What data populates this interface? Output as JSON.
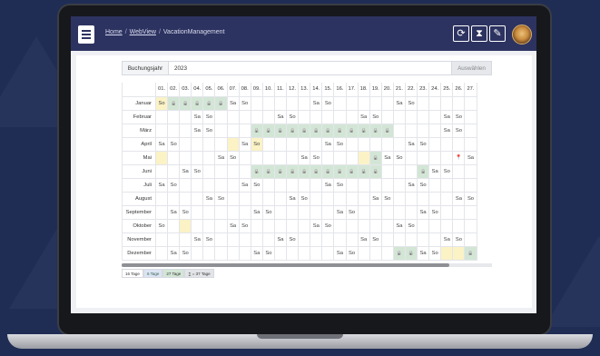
{
  "breadcrumb": {
    "home": "Home",
    "webview": "WebView",
    "current": "VacationManagement",
    "separator": "/"
  },
  "toolbar": {
    "icons": [
      "refresh-icon",
      "hourglass-icon",
      "pencil-icon"
    ]
  },
  "year_selector": {
    "label": "Buchungsjahr",
    "value": "2023",
    "button": "Auswählen"
  },
  "calendar": {
    "day_headers": [
      "01.",
      "02.",
      "03.",
      "04.",
      "05.",
      "06.",
      "07.",
      "08.",
      "09.",
      "10.",
      "11.",
      "12.",
      "13.",
      "14.",
      "15.",
      "16.",
      "17.",
      "18.",
      "19.",
      "20.",
      "21.",
      "22.",
      "23.",
      "24.",
      "25.",
      "26.",
      "27."
    ],
    "months": [
      {
        "name": "Januar",
        "cells": {
          "1": "So",
          "7": "Sa",
          "8": "So",
          "14": "Sa",
          "15": "So",
          "21": "Sa",
          "22": "So"
        },
        "booked": [
          2,
          3,
          4,
          5,
          6
        ],
        "highlight": [
          1
        ]
      },
      {
        "name": "Februar",
        "cells": {
          "4": "Sa",
          "5": "So",
          "11": "Sa",
          "12": "So",
          "18": "Sa",
          "19": "So",
          "25": "Sa",
          "26": "So"
        },
        "booked": [],
        "highlight": []
      },
      {
        "name": "März",
        "cells": {
          "4": "Sa",
          "5": "So",
          "11": "Sa",
          "12": "So",
          "18": "Sa",
          "19": "So",
          "25": "Sa",
          "26": "So"
        },
        "booked": [
          9,
          10,
          11,
          12,
          13,
          14,
          15,
          16,
          17,
          18,
          19,
          20
        ],
        "highlight": []
      },
      {
        "name": "April",
        "cells": {
          "1": "Sa",
          "2": "So",
          "8": "Sa",
          "9": "So",
          "15": "Sa",
          "16": "So",
          "22": "Sa",
          "23": "So"
        },
        "booked": [],
        "highlight": [
          7,
          9
        ]
      },
      {
        "name": "Mai",
        "cells": {
          "6": "Sa",
          "7": "So",
          "13": "Sa",
          "14": "So",
          "20": "Sa",
          "21": "So",
          "27": "Sa"
        },
        "booked": [
          19
        ],
        "highlight": [
          1,
          18
        ],
        "pin": 26
      },
      {
        "name": "Juni",
        "cells": {
          "3": "Sa",
          "4": "So",
          "10": "Sa",
          "11": "So",
          "17": "Sa",
          "18": "So",
          "24": "Sa",
          "25": "So"
        },
        "booked": [
          9,
          10,
          11,
          12,
          13,
          14,
          15,
          16,
          17,
          18,
          19,
          23
        ],
        "highlight": []
      },
      {
        "name": "Juli",
        "cells": {
          "1": "Sa",
          "2": "So",
          "8": "Sa",
          "9": "So",
          "15": "Sa",
          "16": "So",
          "22": "Sa",
          "23": "So"
        },
        "booked": [],
        "highlight": []
      },
      {
        "name": "August",
        "cells": {
          "5": "Sa",
          "6": "So",
          "12": "Sa",
          "13": "So",
          "19": "Sa",
          "20": "So",
          "26": "Sa",
          "27": "So"
        },
        "booked": [],
        "highlight": []
      },
      {
        "name": "September",
        "cells": {
          "2": "Sa",
          "3": "So",
          "9": "Sa",
          "10": "So",
          "16": "Sa",
          "17": "So",
          "23": "Sa",
          "24": "So"
        },
        "booked": [],
        "highlight": []
      },
      {
        "name": "Oktober",
        "cells": {
          "1": "So",
          "7": "Sa",
          "8": "So",
          "14": "Sa",
          "15": "So",
          "21": "Sa",
          "22": "So"
        },
        "booked": [],
        "highlight": [
          3
        ]
      },
      {
        "name": "November",
        "cells": {
          "4": "Sa",
          "5": "So",
          "11": "Sa",
          "12": "So",
          "18": "Sa",
          "19": "So",
          "25": "Sa",
          "26": "So"
        },
        "booked": [],
        "highlight": []
      },
      {
        "name": "Dezember",
        "cells": {
          "2": "Sa",
          "3": "So",
          "9": "Sa",
          "10": "So",
          "16": "Sa",
          "17": "So",
          "23": "Sa",
          "24": "So"
        },
        "booked": [
          21,
          22,
          27
        ],
        "highlight": [
          25,
          26
        ]
      }
    ]
  },
  "legend": [
    "16 Tage",
    "6 Tage",
    "27 Tage",
    "∑ = 37 Tage"
  ],
  "colors": {
    "topbar": "#2d3360",
    "booked": "#d3e6d6",
    "highlight": "#fbf2c6",
    "pin": "#d63b3b"
  }
}
